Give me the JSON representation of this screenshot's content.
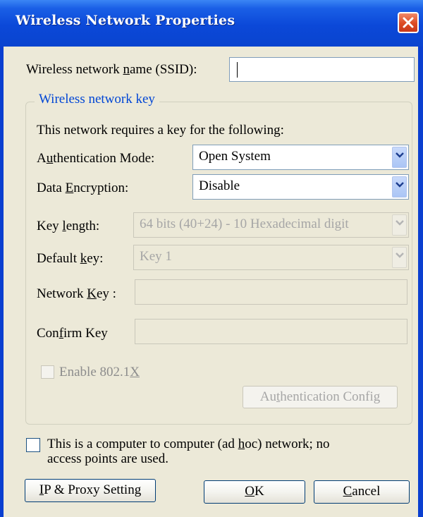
{
  "window": {
    "title": "Wireless Network Properties"
  },
  "ssid": {
    "label": "Wireless network name (SSID):",
    "value": ""
  },
  "wireless_key": {
    "group_label": "Wireless network key",
    "intro": "This network requires a key for the following:",
    "authentication_mode": {
      "label": "Authentication Mode:",
      "value": "Open System"
    },
    "data_encryption": {
      "label": "Data Encryption:",
      "value": "Disable"
    },
    "key_length": {
      "label": "Key length:",
      "value": "64 bits (40+24) - 10 Hexadecimal digit"
    },
    "default_key": {
      "label": "Default key:",
      "value": "Key 1"
    },
    "network_key": {
      "label": "Network Key :",
      "value": ""
    },
    "confirm_key": {
      "label": "Confirm Key",
      "value": ""
    },
    "enable_8021x": {
      "label": "Enable 802.1X",
      "checked": false
    },
    "auth_config_button": "Authentication Config"
  },
  "adhoc": {
    "label_line1": "This is a computer to computer (ad hoc) network; no",
    "label_line2": "access points are used.",
    "checked": false
  },
  "buttons": {
    "ip_proxy": "IP & Proxy Setting",
    "ok": "OK",
    "cancel": "Cancel"
  },
  "colors": {
    "titlebar": "#0a44cf",
    "dialog_bg": "#ece9d8",
    "group_label": "#0046d5",
    "close_button": "#dc4a22"
  },
  "icons": {
    "close": "close-x-icon",
    "dropdown": "chevron-down-icon"
  }
}
